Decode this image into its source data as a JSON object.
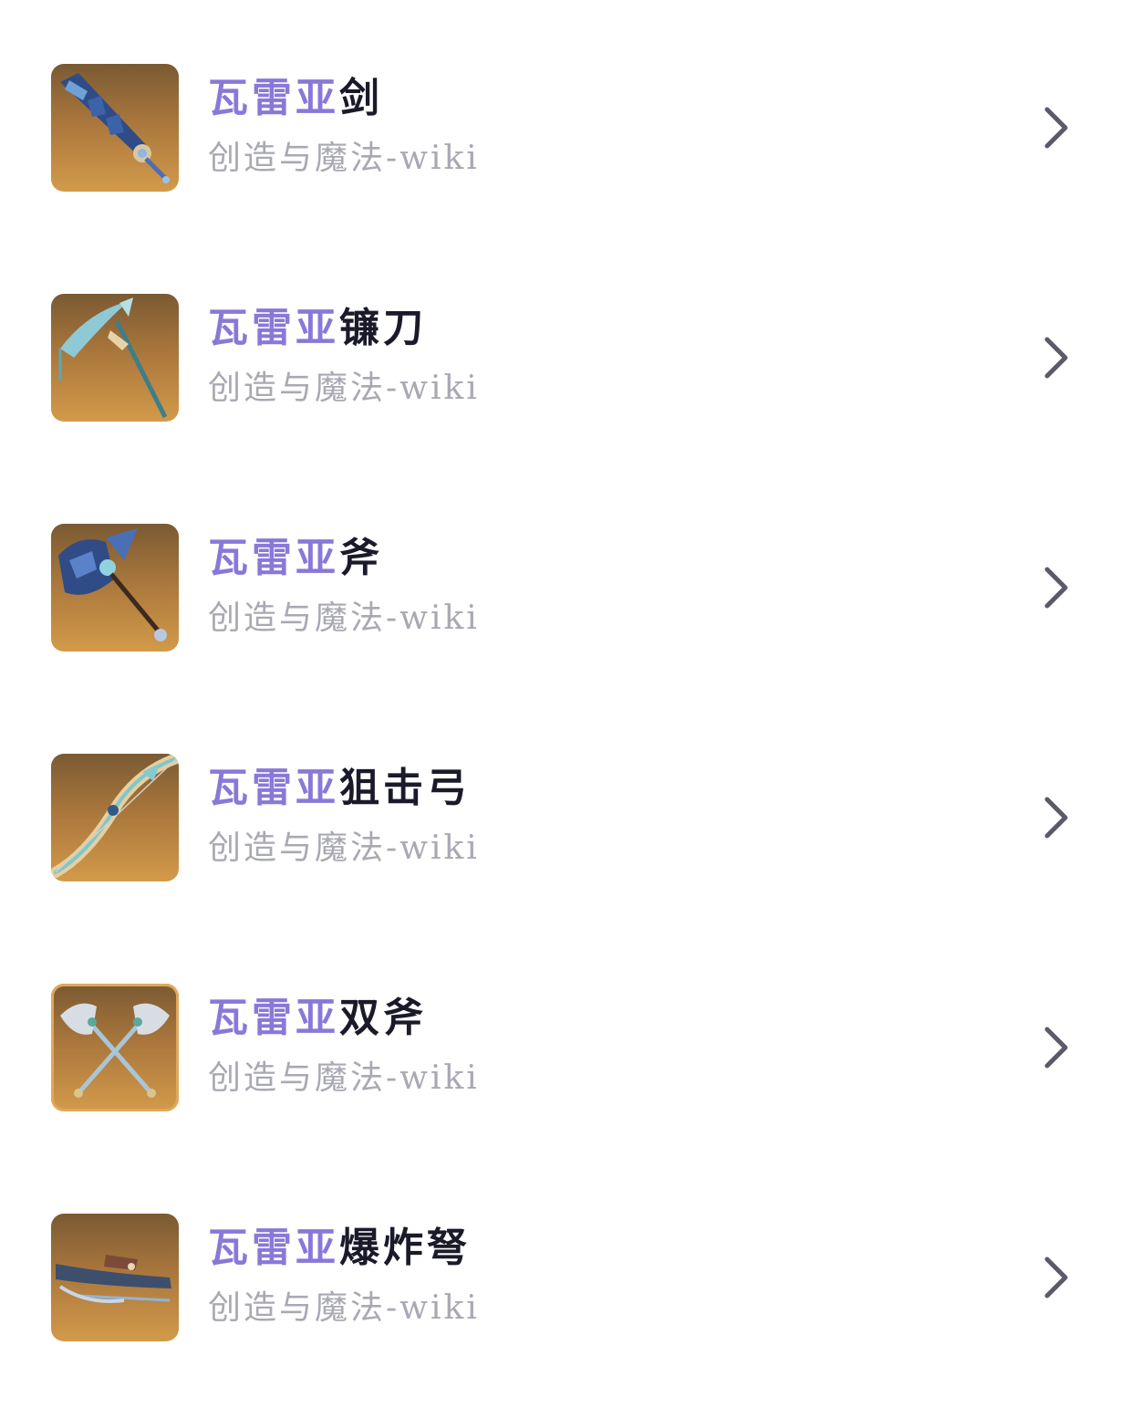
{
  "items": [
    {
      "highlight": "瓦雷亚",
      "title_rest": "剑",
      "subtitle": "创造与魔法-wiki",
      "icon": "sword-icon"
    },
    {
      "highlight": "瓦雷亚",
      "title_rest": "镰刀",
      "subtitle": "创造与魔法-wiki",
      "icon": "scythe-icon"
    },
    {
      "highlight": "瓦雷亚",
      "title_rest": "斧",
      "subtitle": "创造与魔法-wiki",
      "icon": "axe-icon"
    },
    {
      "highlight": "瓦雷亚",
      "title_rest": "狙击弓",
      "subtitle": "创造与魔法-wiki",
      "icon": "bow-icon"
    },
    {
      "highlight": "瓦雷亚",
      "title_rest": "双斧",
      "subtitle": "创造与魔法-wiki",
      "icon": "dual-axes-icon"
    },
    {
      "highlight": "瓦雷亚",
      "title_rest": "爆炸弩",
      "subtitle": "创造与魔法-wiki",
      "icon": "crossbow-icon"
    }
  ],
  "colors": {
    "highlight": "#8a78d8",
    "title": "#1a1a2a",
    "subtitle": "#a9a9b4",
    "chevron": "#5a5a6a",
    "thumb_top": "#7a5a33",
    "thumb_bottom": "#d39a4a"
  }
}
